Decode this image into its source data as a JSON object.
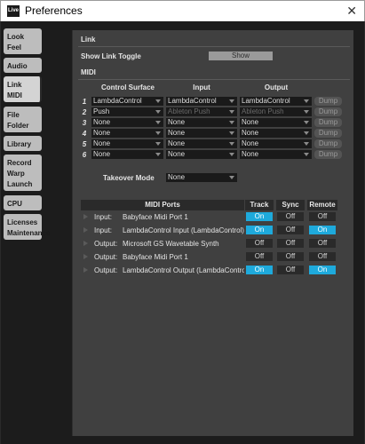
{
  "window": {
    "app_logo": "Live",
    "title": "Preferences",
    "close_glyph": "✕"
  },
  "tabs": [
    {
      "id": "look-feel",
      "lines": [
        "Look",
        "Feel"
      ],
      "active": false
    },
    {
      "id": "audio",
      "lines": [
        "Audio"
      ],
      "active": false
    },
    {
      "id": "link-midi",
      "lines": [
        "Link",
        "MIDI"
      ],
      "active": true
    },
    {
      "id": "file-folder",
      "lines": [
        "File",
        "Folder"
      ],
      "active": false
    },
    {
      "id": "library",
      "lines": [
        "Library"
      ],
      "active": false
    },
    {
      "id": "record-warp-launch",
      "lines": [
        "Record",
        "Warp",
        "Launch"
      ],
      "active": false
    },
    {
      "id": "cpu",
      "lines": [
        "CPU"
      ],
      "active": false
    },
    {
      "id": "licenses-maintenance",
      "lines": [
        "Licenses",
        "Maintenance"
      ],
      "active": false
    }
  ],
  "link": {
    "heading": "Link",
    "toggle_label": "Show Link Toggle",
    "toggle_value": "Show"
  },
  "midi": {
    "heading": "MIDI",
    "columns": {
      "surface": "Control Surface",
      "input": "Input",
      "output": "Output"
    },
    "rows": [
      {
        "num": "1",
        "surface": "LambdaControl",
        "input": "LambdaControl",
        "output": "LambdaControl",
        "input_dim": false,
        "output_dim": false,
        "dump": "Dump"
      },
      {
        "num": "2",
        "surface": "Push",
        "input": "Ableton Push",
        "output": "Ableton Push",
        "input_dim": true,
        "output_dim": true,
        "dump": "Dump"
      },
      {
        "num": "3",
        "surface": "None",
        "input": "None",
        "output": "None",
        "input_dim": false,
        "output_dim": false,
        "dump": "Dump"
      },
      {
        "num": "4",
        "surface": "None",
        "input": "None",
        "output": "None",
        "input_dim": false,
        "output_dim": false,
        "dump": "Dump"
      },
      {
        "num": "5",
        "surface": "None",
        "input": "None",
        "output": "None",
        "input_dim": false,
        "output_dim": false,
        "dump": "Dump"
      },
      {
        "num": "6",
        "surface": "None",
        "input": "None",
        "output": "None",
        "input_dim": false,
        "output_dim": false,
        "dump": "Dump"
      }
    ],
    "takeover_label": "Takeover Mode",
    "takeover_value": "None"
  },
  "ports": {
    "headers": {
      "ports": "MIDI Ports",
      "track": "Track",
      "sync": "Sync",
      "remote": "Remote"
    },
    "rows": [
      {
        "dir": "Input:",
        "name": "Babyface Midi Port 1",
        "track": "On",
        "sync": "Off",
        "remote": "Off"
      },
      {
        "dir": "Input:",
        "name": "LambdaControl Input (LambdaControl)",
        "track": "On",
        "sync": "Off",
        "remote": "On"
      },
      {
        "dir": "Output:",
        "name": "Microsoft GS Wavetable Synth",
        "track": "Off",
        "sync": "Off",
        "remote": "Off"
      },
      {
        "dir": "Output:",
        "name": "Babyface Midi Port 1",
        "track": "Off",
        "sync": "Off",
        "remote": "Off"
      },
      {
        "dir": "Output:",
        "name": "LambdaControl Output (LambdaControl)",
        "track": "On",
        "sync": "Off",
        "remote": "On"
      }
    ]
  },
  "colors": {
    "on": "#1eaadc",
    "panel": "#404040",
    "frame": "#1c1c1c"
  }
}
